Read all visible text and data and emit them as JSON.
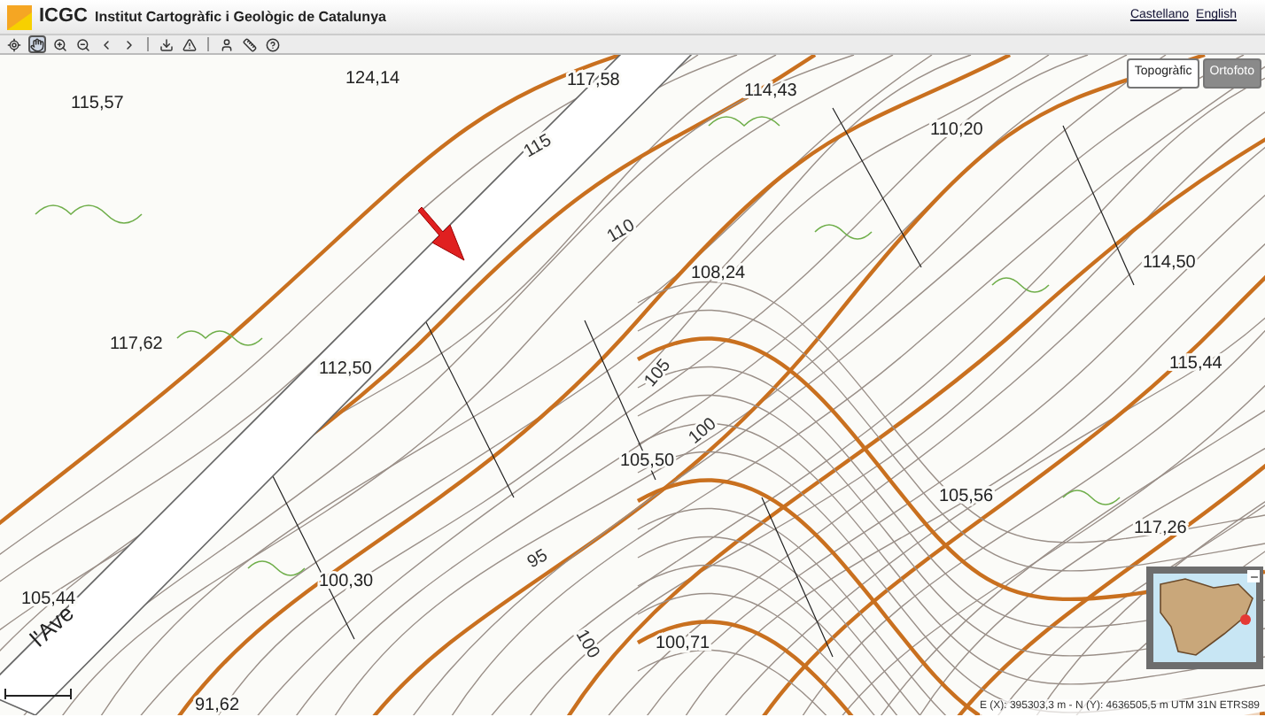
{
  "header": {
    "logo": "ICGC",
    "title": "Institut Cartogràfic i Geològic de Catalunya",
    "languages": [
      "Castellano",
      "English"
    ]
  },
  "toolbar": [
    {
      "kind": "extent",
      "selected": false
    },
    {
      "kind": "pan",
      "selected": true
    },
    {
      "kind": "zoom-in",
      "selected": false
    },
    {
      "kind": "zoom-out",
      "selected": false
    },
    {
      "kind": "back",
      "selected": false
    },
    {
      "kind": "forward",
      "selected": false
    },
    {
      "kind": "divider"
    },
    {
      "kind": "download",
      "selected": false
    },
    {
      "kind": "warning",
      "selected": false
    },
    {
      "kind": "divider"
    },
    {
      "kind": "person",
      "selected": false
    },
    {
      "kind": "measure",
      "selected": false
    },
    {
      "kind": "help",
      "selected": false
    }
  ],
  "layers": [
    {
      "label": "Topogràfic",
      "selected": true
    },
    {
      "label": "Ortofoto",
      "selected": false
    }
  ],
  "map": {
    "spot_heights": [
      "124,14",
      "115,57",
      "117,58",
      "114,43",
      "110,20",
      "108,24",
      "117,62",
      "114,50",
      "112,50",
      "115,44",
      "105,50",
      "105,56",
      "117,26",
      "105,44",
      "100,30",
      "100,71",
      "91,62"
    ],
    "contour_labels": [
      "115",
      "110",
      "105",
      "100",
      "95",
      "100"
    ],
    "road_label": "l'Ave"
  },
  "coordinates": "E (X): 395303,3 m - N (Y): 4636505,5 m UTM 31N ETRS89"
}
